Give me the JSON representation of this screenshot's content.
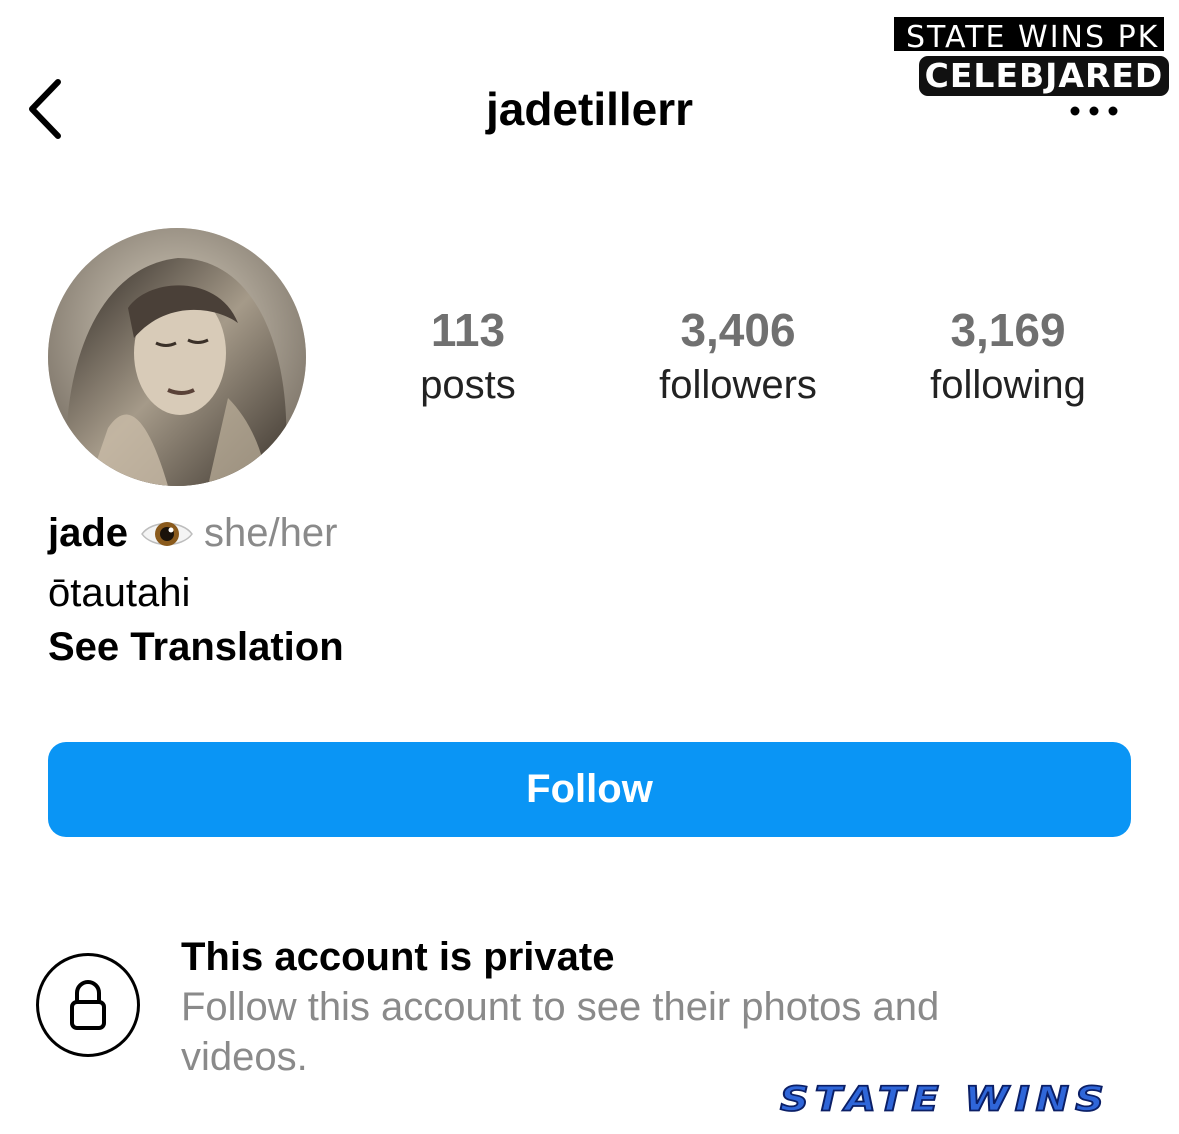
{
  "header": {
    "username": "jadetillerr"
  },
  "watermark_top": {
    "line1": "STATE WINS PK",
    "line2": "CELEBJARED"
  },
  "stats": [
    {
      "value": "113",
      "label": "posts"
    },
    {
      "value": "3,406",
      "label": "followers"
    },
    {
      "value": "3,169",
      "label": "following"
    }
  ],
  "bio": {
    "name": "jade",
    "emoji_icon": "eye-icon",
    "pronouns": "she/her",
    "location": "ōtautahi",
    "translate_label": "See Translation"
  },
  "follow_button": {
    "label": "Follow",
    "color": "#0a95f5"
  },
  "private_notice": {
    "title": "This account is private",
    "text": "Follow this account to see their photos and videos."
  },
  "watermark_bottom": "STATE WINS"
}
